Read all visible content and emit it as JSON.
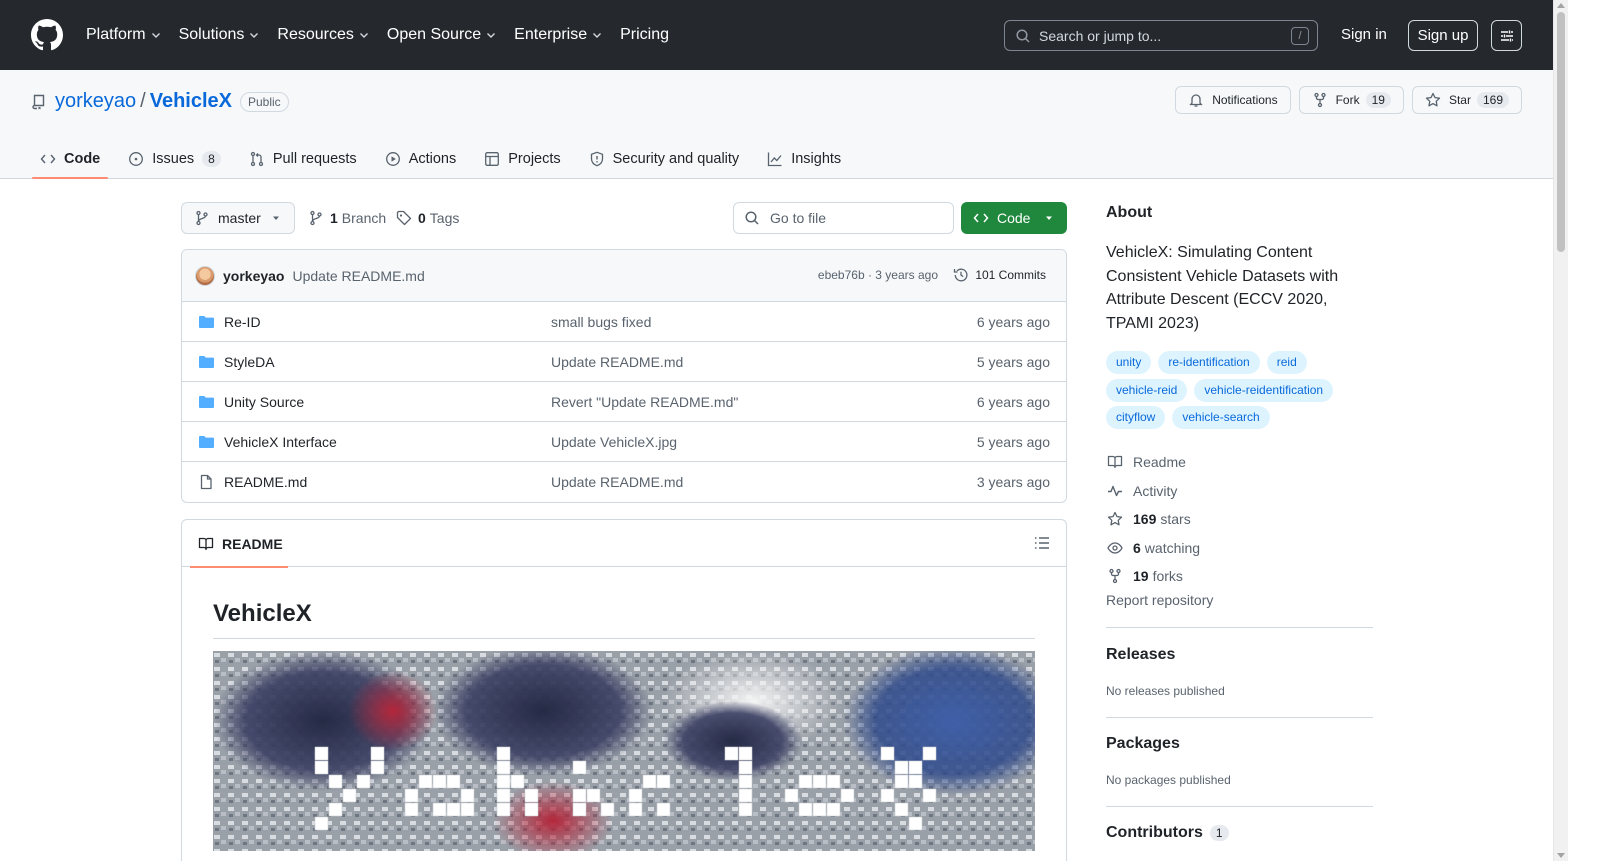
{
  "header": {
    "nav": [
      {
        "label": "Platform"
      },
      {
        "label": "Solutions"
      },
      {
        "label": "Resources"
      },
      {
        "label": "Open Source"
      },
      {
        "label": "Enterprise"
      },
      {
        "label": "Pricing"
      }
    ],
    "search_placeholder": "Search or jump to...",
    "search_shortcut": "/",
    "signin": "Sign in",
    "signup": "Sign up"
  },
  "repo": {
    "owner": "yorkeyao",
    "separator": "/",
    "name": "VehicleX",
    "visibility": "Public",
    "notifications": "Notifications",
    "fork_label": "Fork",
    "fork_count": "19",
    "star_label": "Star",
    "star_count": "169"
  },
  "tabs": [
    {
      "label": "Code"
    },
    {
      "label": "Issues",
      "count": "8"
    },
    {
      "label": "Pull requests"
    },
    {
      "label": "Actions"
    },
    {
      "label": "Projects"
    },
    {
      "label": "Security and quality"
    },
    {
      "label": "Insights"
    }
  ],
  "toolbar": {
    "branch": "master",
    "branch_count": "1",
    "branch_label": "Branch",
    "tag_count": "0",
    "tag_label": "Tags",
    "goto_placeholder": "Go to file",
    "code_label": "Code"
  },
  "latest_commit": {
    "author": "yorkeyao",
    "message": "Update README.md",
    "meta": "ebeb76b · 3 years ago",
    "commits": "101 Commits"
  },
  "files": [
    {
      "name": "Re-ID",
      "type": "folder",
      "message": "small bugs fixed",
      "time": "6 years ago"
    },
    {
      "name": "StyleDA",
      "type": "folder",
      "message": "Update README.md",
      "time": "5 years ago"
    },
    {
      "name": "Unity Source",
      "type": "folder",
      "message": "Revert \"Update README.md\"",
      "time": "6 years ago"
    },
    {
      "name": "VehicleX Interface",
      "type": "folder",
      "message": "Update VehicleX.jpg",
      "time": "5 years ago"
    },
    {
      "name": "README.md",
      "type": "file",
      "message": "Update README.md",
      "time": "3 years ago"
    }
  ],
  "readme": {
    "tab_label": "README",
    "heading": "VehicleX"
  },
  "about": {
    "heading": "About",
    "description": "VehicleX: Simulating Content Consistent Vehicle Datasets with Attribute Descent (ECCV 2020, TPAMI 2023)",
    "topics": [
      "unity",
      "re-identification",
      "reid",
      "vehicle-reid",
      "vehicle-reidentification",
      "cityflow",
      "vehicle-search"
    ],
    "readme_link": "Readme",
    "activity_link": "Activity",
    "stars_count": "169",
    "stars_label": "stars",
    "watching_count": "6",
    "watching_label": "watching",
    "forks_count": "19",
    "forks_label": "forks",
    "report": "Report repository"
  },
  "releases": {
    "heading": "Releases",
    "empty": "No releases published"
  },
  "packages": {
    "heading": "Packages",
    "empty": "No packages published"
  },
  "contributors": {
    "heading": "Contributors",
    "count": "1"
  },
  "colors": {
    "header_bg": "#25292e",
    "link": "#0969da",
    "green_button": "#1f883d",
    "tab_underline": "#fd8c73"
  }
}
